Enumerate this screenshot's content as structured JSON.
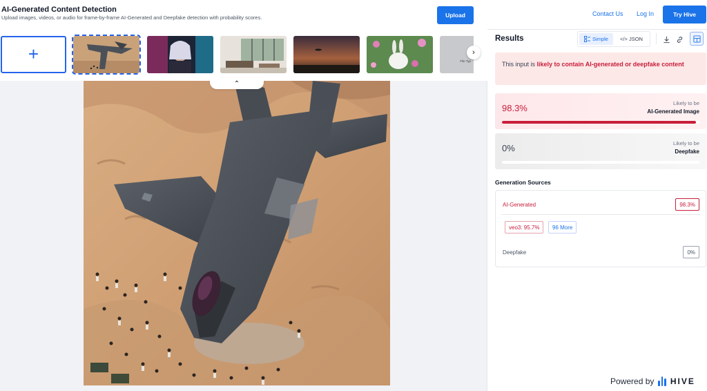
{
  "header": {
    "title": "AI-Generated Content Detection",
    "subtitle": "Upload images, videos, or audio for frame-by-frame AI-Generated and Deepfake detection with probability scores.",
    "upload_label": "Upload"
  },
  "thumbnails": {
    "add_symbol": "+",
    "file_type_caption": "File Typ",
    "next_symbol": "›",
    "collapse_symbol": "⌃"
  },
  "nav": {
    "contact_label": "Contact Us",
    "login_label": "Log In",
    "try_label": "Try Hive"
  },
  "results": {
    "title": "Results",
    "toggle_simple": "Simple",
    "toggle_json": "</> JSON",
    "verdict_prefix": "This input is ",
    "verdict_highlight": "likely to contain AI-generated or deepfake content",
    "scores": [
      {
        "value": "98.3%",
        "caption": "Likely to be",
        "label": "AI-Generated Image",
        "fraction": 0.983
      },
      {
        "value": "0%",
        "caption": "Likely to be",
        "label": "Deepfake",
        "fraction": 0
      }
    ],
    "generation_title": "Generation Sources",
    "ai_label": "AI-Generated",
    "ai_badge": "98.3%",
    "source_chip": "veo3: 95.7%",
    "more_chip": "96 More",
    "deepfake_label": "Deepfake",
    "deepfake_badge": "0%"
  },
  "footer": {
    "powered_by": "Powered by",
    "brand": "HIVE"
  },
  "colors": {
    "accent": "#1a73e8",
    "alert": "#c81e3a"
  }
}
